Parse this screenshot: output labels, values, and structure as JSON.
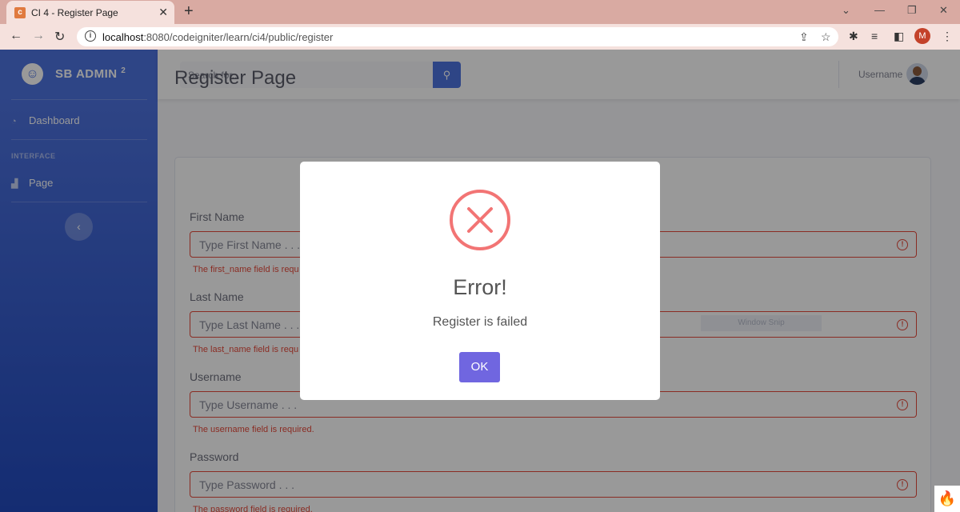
{
  "browser": {
    "tab_title": "CI 4 - Register Page",
    "tab_favicon": "codeigniter-favicon",
    "url_host": "localhost",
    "url_rest": ":8080/codeigniter/learn/ci4/public/register",
    "profile_initial": "M"
  },
  "sidebar": {
    "brand": "SB ADMIN",
    "brand_sup": "2",
    "items": [
      {
        "label": "Dashboard",
        "icon": "tachometer-icon"
      },
      {
        "label": "Page",
        "icon": "chart-area-icon"
      }
    ],
    "heading": "INTERFACE",
    "toggle_icon": "chevron-left-icon"
  },
  "topbar": {
    "search_placeholder": "Search for...",
    "username": "Username"
  },
  "page": {
    "title": "Register Page",
    "fields": [
      {
        "label": "First Name",
        "placeholder": "Type First Name . . .",
        "error": "The first_name field is requ"
      },
      {
        "label": "Last Name",
        "placeholder": "Type Last Name . . .",
        "error": "The last_name field is requ"
      },
      {
        "label": "Username",
        "placeholder": "Type Username . . .",
        "error": "The username field is required."
      },
      {
        "label": "Password",
        "placeholder": "Type Password . . .",
        "error": "The password field is required."
      }
    ]
  },
  "watermark": "Window Snip",
  "modal": {
    "icon": "error-x-icon",
    "title": "Error!",
    "text": "Register is failed",
    "ok_label": "OK"
  },
  "colors": {
    "sidebar": "#4e73df",
    "error": "#e74a3b",
    "modal_button": "#7066e0",
    "modal_icon": "#f27474"
  }
}
